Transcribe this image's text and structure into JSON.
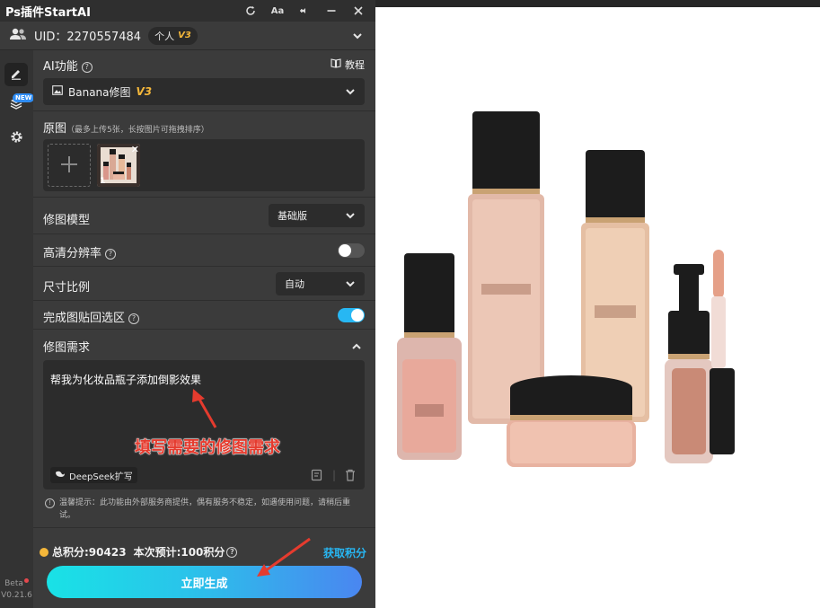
{
  "titlebar": {
    "title": "Ps插件StartAI",
    "icons": [
      "refresh-icon",
      "font-size-icon",
      "pin-icon",
      "minimize-icon",
      "close-icon"
    ],
    "font_icon_text": "Aa"
  },
  "user": {
    "uid_text": "UID：2270557484",
    "plan": "个人",
    "plan_version": "V3"
  },
  "sidebar": {
    "items": [
      "edit-icon",
      "layers-icon",
      "settings-icon"
    ],
    "new_tag": "NEW",
    "beta": "Beta",
    "version": "V0.21.6"
  },
  "ai_function": {
    "label": "AI功能",
    "tutorial": "教程",
    "selected": "Banana修图",
    "version": "V3"
  },
  "original_image": {
    "label": "原图",
    "hint": "（最多上传5张，长按图片可拖拽排序）",
    "thumb_index": "1"
  },
  "model": {
    "label": "修图模型",
    "value": "基础版"
  },
  "hd_resolution": {
    "label": "高清分辨率",
    "enabled": false
  },
  "aspect_ratio": {
    "label": "尺寸比例",
    "value": "自动"
  },
  "paste_back": {
    "label": "完成图贴回选区",
    "enabled": true
  },
  "requirement": {
    "label": "修图需求",
    "text": "帮我为化妆品瓶子添加倒影效果",
    "deepseek": "DeepSeek扩写"
  },
  "annotation": "填写需要的修图需求",
  "tip": "温馨提示：此功能由外部服务商提供，偶有服务不稳定，如遇使用问题，请稍后重试。",
  "points": {
    "total": "总积分:90423",
    "estimate": "本次预计:100积分",
    "get": "获取积分"
  },
  "generate_button": "立即生成",
  "colors": {
    "accent_blue": "#27b7f3",
    "toggle_on": "#27b7f3",
    "version_gold": "#f4b73a",
    "annotation_red": "#e53b2e"
  }
}
